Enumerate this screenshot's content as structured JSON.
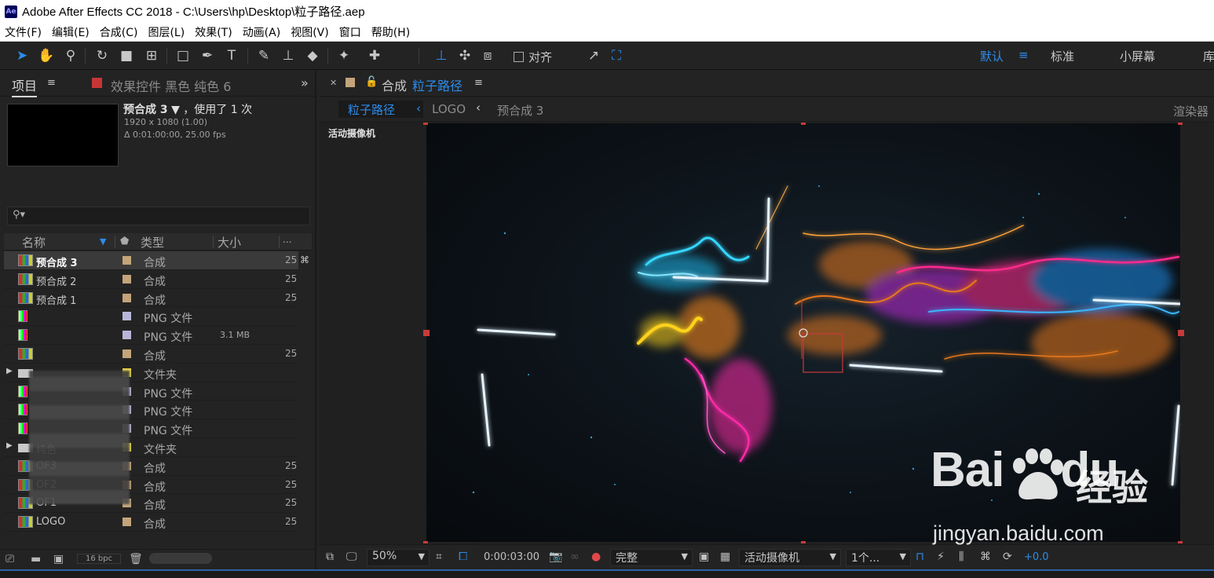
{
  "window": {
    "icon_text": "Ae",
    "title": "Adobe After Effects CC 2018 - C:\\Users\\hp\\Desktop\\粒子路径.aep"
  },
  "menu": [
    "文件(F)",
    "编辑(E)",
    "合成(C)",
    "图层(L)",
    "效果(T)",
    "动画(A)",
    "视图(V)",
    "窗口",
    "帮助(H)"
  ],
  "toolbar": {
    "align_label": "对齐",
    "workspaces": [
      "默认",
      "标准",
      "小屏幕",
      "库"
    ],
    "workspace_menu": "≡"
  },
  "project_panel": {
    "tab_label": "项目",
    "tab_menu": "≡",
    "effects_tab_label": "效果控件 黑色 纯色 6",
    "expand": "»",
    "selected_name": "预合成 3",
    "selected_suffix": "▼ ，使用了 1 次",
    "resolution": "1920 x 1080 (1.00)",
    "duration": "Δ 0:01:00:00, 25.00 fps",
    "search_icon": "⚲▾",
    "columns": {
      "name": "名称",
      "type": "类型",
      "size": "大小",
      "more": "..."
    },
    "bpc": "16 bpc"
  },
  "items": [
    {
      "name": "预合成 3",
      "type": "合成",
      "size": "",
      "fps": "25",
      "icon": "comp",
      "label_color": "#c4a47a",
      "selected": true,
      "flow": "⌘"
    },
    {
      "name": "预合成 2",
      "type": "合成",
      "size": "",
      "fps": "25",
      "icon": "comp",
      "label_color": "#c4a47a"
    },
    {
      "name": "预合成 1",
      "type": "合成",
      "size": "",
      "fps": "25",
      "icon": "comp",
      "label_color": "#c4a47a"
    },
    {
      "name": "",
      "type": "PNG 文件",
      "size": "",
      "fps": "",
      "icon": "png",
      "label_color": "#b8b6d8"
    },
    {
      "name": "",
      "type": "PNG 文件",
      "size": "3.1 MB",
      "fps": "",
      "icon": "png",
      "label_color": "#b8b6d8"
    },
    {
      "name": "",
      "type": "合成",
      "size": "",
      "fps": "25",
      "icon": "comp",
      "label_color": "#c4a47a"
    },
    {
      "name": "",
      "type": "文件夹",
      "size": "",
      "fps": "",
      "icon": "folder",
      "label_color": "#e8d44a",
      "caret": "▶"
    },
    {
      "name": "",
      "type": "PNG 文件",
      "size": "",
      "fps": "",
      "icon": "png",
      "label_color": "#b8b6d8"
    },
    {
      "name": "",
      "type": "PNG 文件",
      "size": "",
      "fps": "",
      "icon": "png",
      "label_color": "#b8b6d8"
    },
    {
      "name": "",
      "type": "PNG 文件",
      "size": "",
      "fps": "",
      "icon": "png",
      "label_color": "#b8b6d8"
    },
    {
      "name": "纯色",
      "type": "文件夹",
      "size": "",
      "fps": "",
      "icon": "folder",
      "label_color": "#e8d44a",
      "caret": "▶"
    },
    {
      "name": "OF3",
      "type": "合成",
      "size": "",
      "fps": "25",
      "icon": "comp",
      "label_color": "#c4a47a"
    },
    {
      "name": "OF2",
      "type": "合成",
      "size": "",
      "fps": "25",
      "icon": "comp",
      "label_color": "#c4a47a"
    },
    {
      "name": "OF1",
      "type": "合成",
      "size": "",
      "fps": "25",
      "icon": "comp",
      "label_color": "#c4a47a"
    },
    {
      "name": "LOGO",
      "type": "合成",
      "size": "",
      "fps": "25",
      "icon": "comp",
      "label_color": "#c4a47a"
    }
  ],
  "comp_panel": {
    "tab_prefix": "合成",
    "tab_name": "粒子路径",
    "tab_menu": "≡",
    "crumbs": [
      "粒子路径",
      "LOGO",
      "预合成 3"
    ],
    "renderer": "渲染器",
    "camera_label": "活动摄像机",
    "zoom": "50%",
    "timecode": "0:00:03:00",
    "resolution": "完整",
    "camera": "活动摄像机",
    "views": "1个...",
    "exposure": "+0.0"
  },
  "watermark": {
    "brand": "Bai",
    "brand2": "du",
    "cn": "经验",
    "url": "jingyan.baidu.com"
  },
  "colors": {
    "accent": "#2d8ceb",
    "handle": "#c83a3a"
  }
}
